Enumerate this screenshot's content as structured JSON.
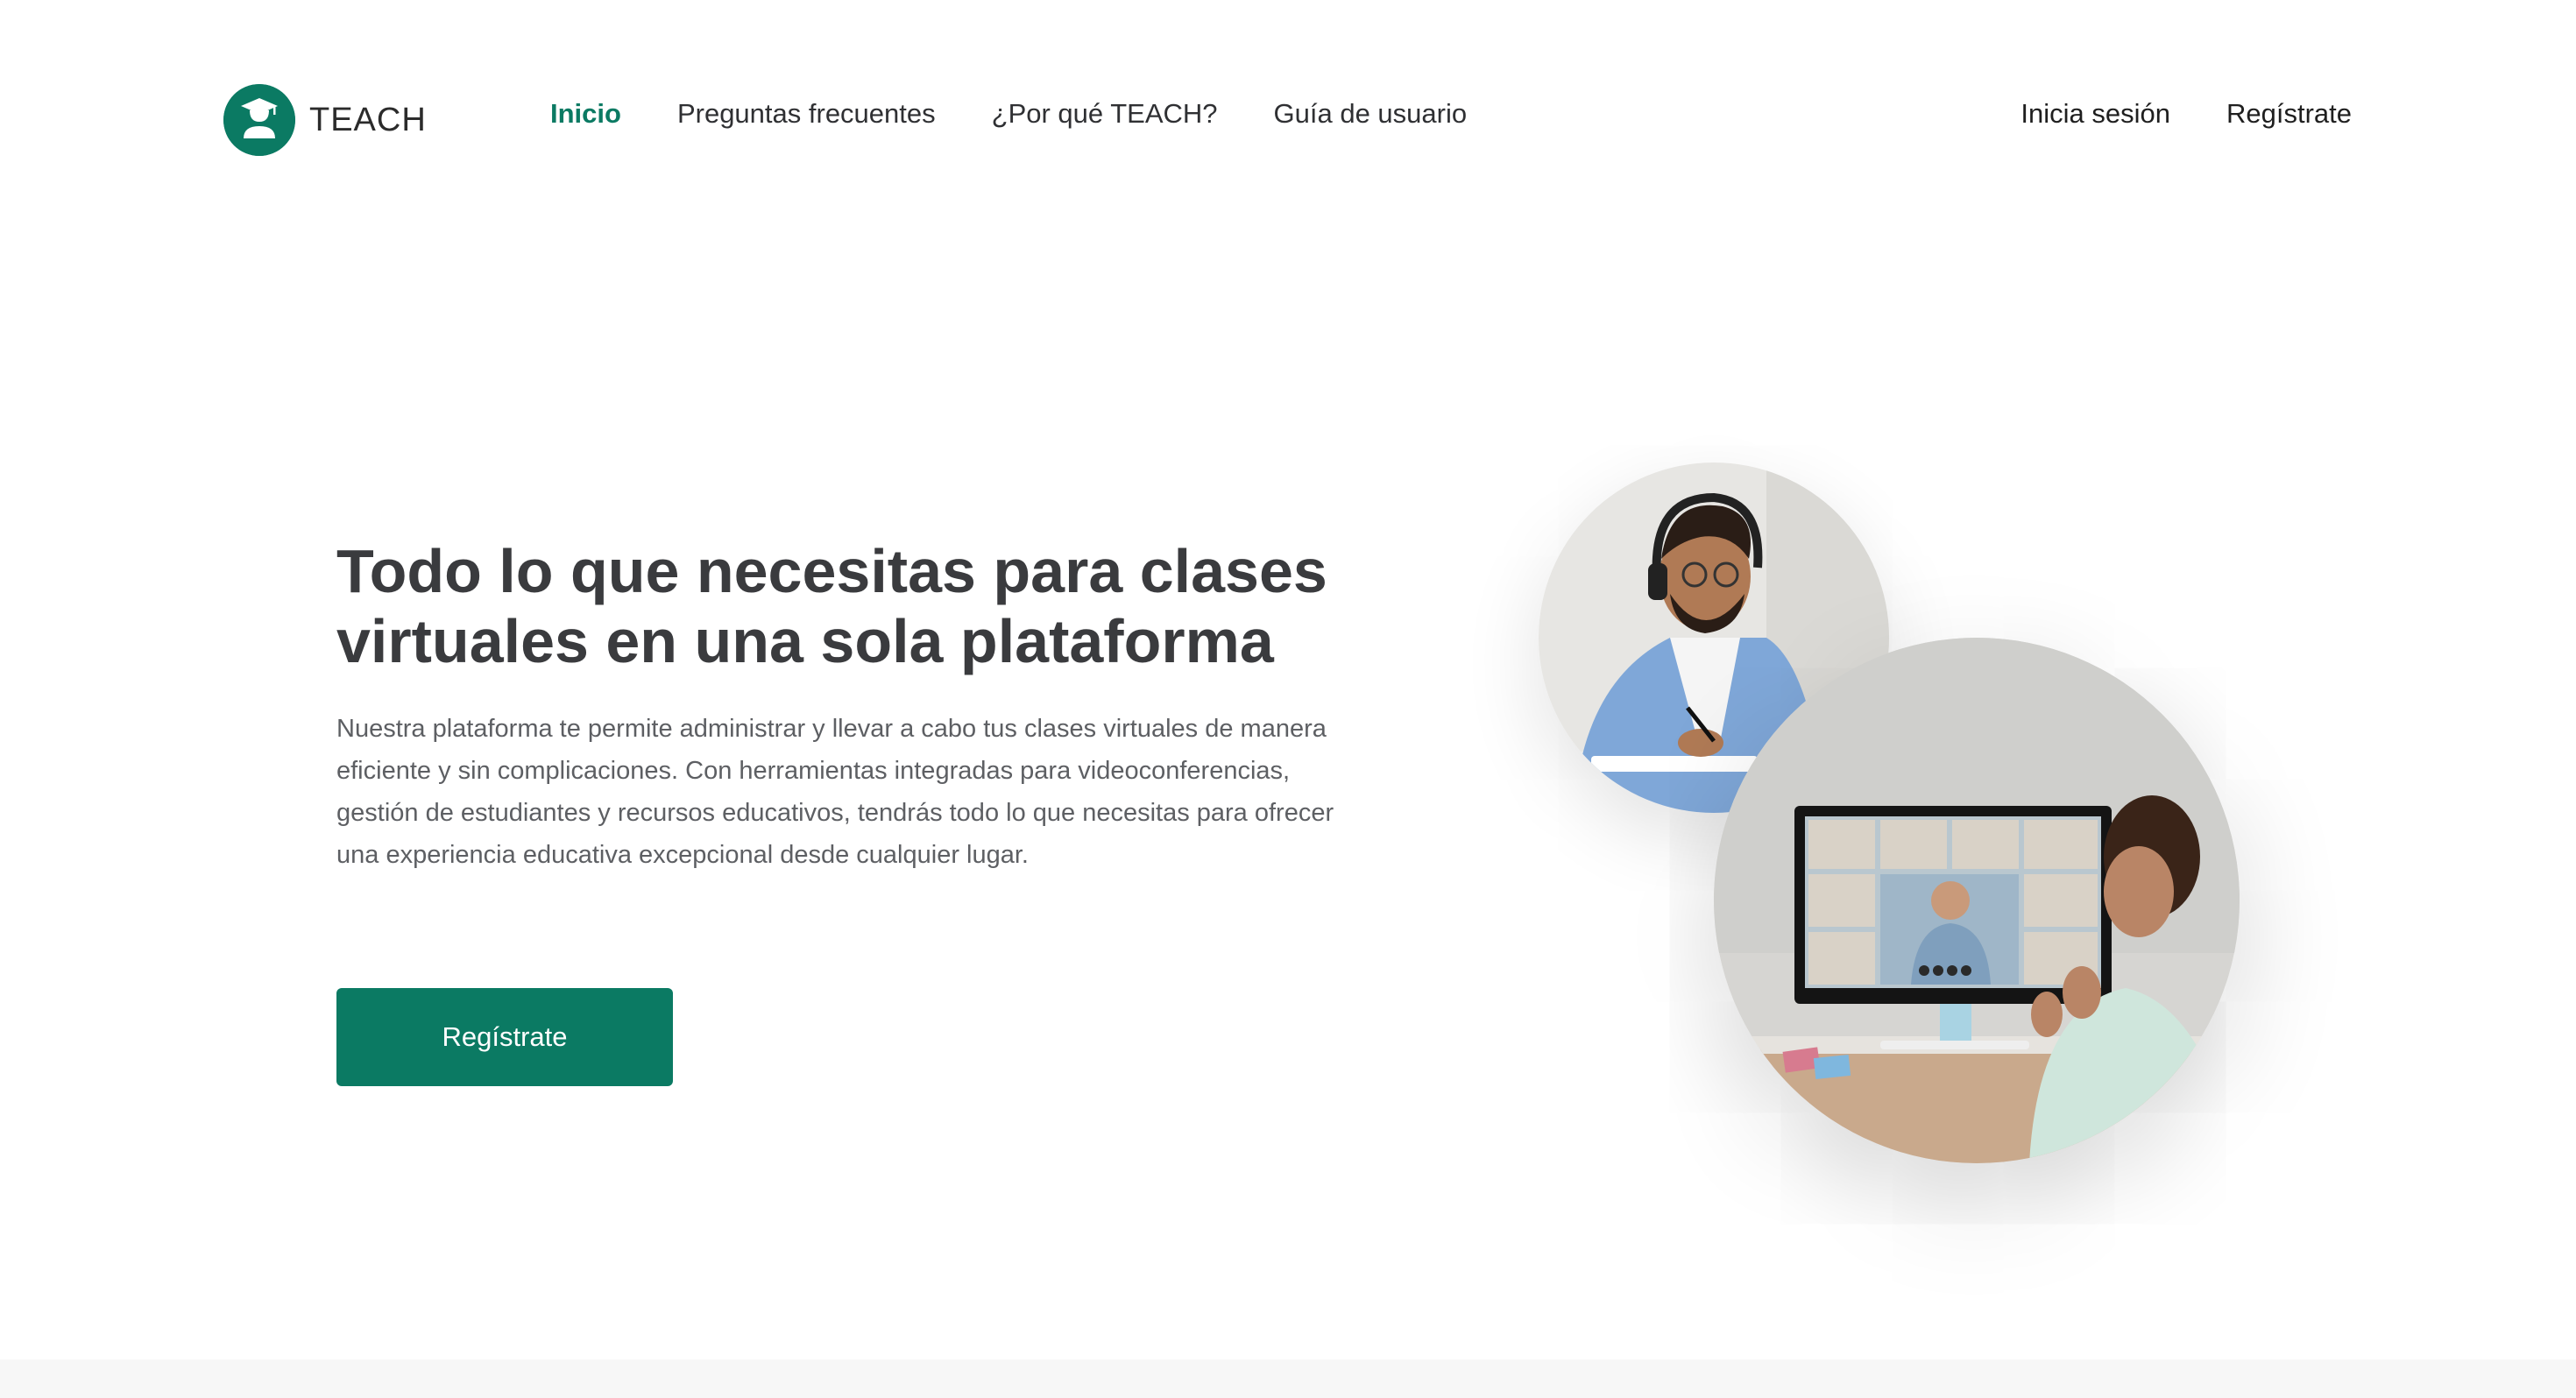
{
  "brand": {
    "name": "TEACH",
    "color": "#0b7a63",
    "logo_icon": "graduate-cap-user-icon"
  },
  "nav": {
    "items": [
      {
        "label": "Inicio",
        "active": true
      },
      {
        "label": "Preguntas frecuentes",
        "active": false
      },
      {
        "label": "¿Por qué TEACH?",
        "active": false
      },
      {
        "label": "Guía de usuario",
        "active": false
      }
    ]
  },
  "auth": {
    "login_label": "Inicia sesión",
    "register_label": "Regístrate"
  },
  "hero": {
    "title": "Todo lo que necesitas para clases virtuales en una sola plataforma",
    "description": "Nuestra plataforma te permite administrar y llevar a cabo tus clases virtuales de manera eficiente y sin complicaciones. Con herramientas integradas para videoconferencias, gestión de estudiantes y recursos educativos, tendrás todo lo que necesitas para ofrecer una experiencia educativa excepcional desde cualquier lugar.",
    "cta_label": "Regístrate"
  },
  "images": {
    "small_photo": "man-with-headphones-writing-photo",
    "large_photo": "woman-video-conference-photo"
  }
}
